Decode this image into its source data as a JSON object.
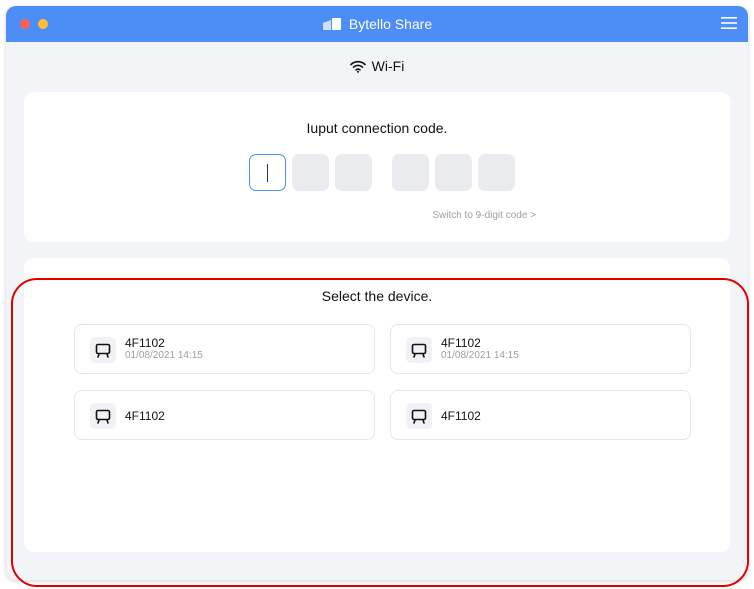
{
  "app": {
    "title": "Bytello Share",
    "accent_color": "#4d8df7",
    "icons": {
      "logo": "bytello-logo-icon",
      "menu": "hamburger-menu-icon"
    }
  },
  "network": {
    "label": "Wi-Fi",
    "icon": "wifi-icon"
  },
  "connection": {
    "title": "Iuput connection code.",
    "digits": [
      "",
      "",
      "",
      "",
      "",
      ""
    ],
    "switch_label": "Switch to 9-digit code >"
  },
  "devices": {
    "title": "Select the device.",
    "icon": "screen-device-icon",
    "items": [
      {
        "name": "4F1102",
        "date": "01/08/2021 14:15"
      },
      {
        "name": "4F1102",
        "date": "01/08/2021 14:15"
      },
      {
        "name": "4F1102"
      },
      {
        "name": "4F1102"
      }
    ]
  },
  "annotation": {
    "highlight_color": "#e00000"
  }
}
